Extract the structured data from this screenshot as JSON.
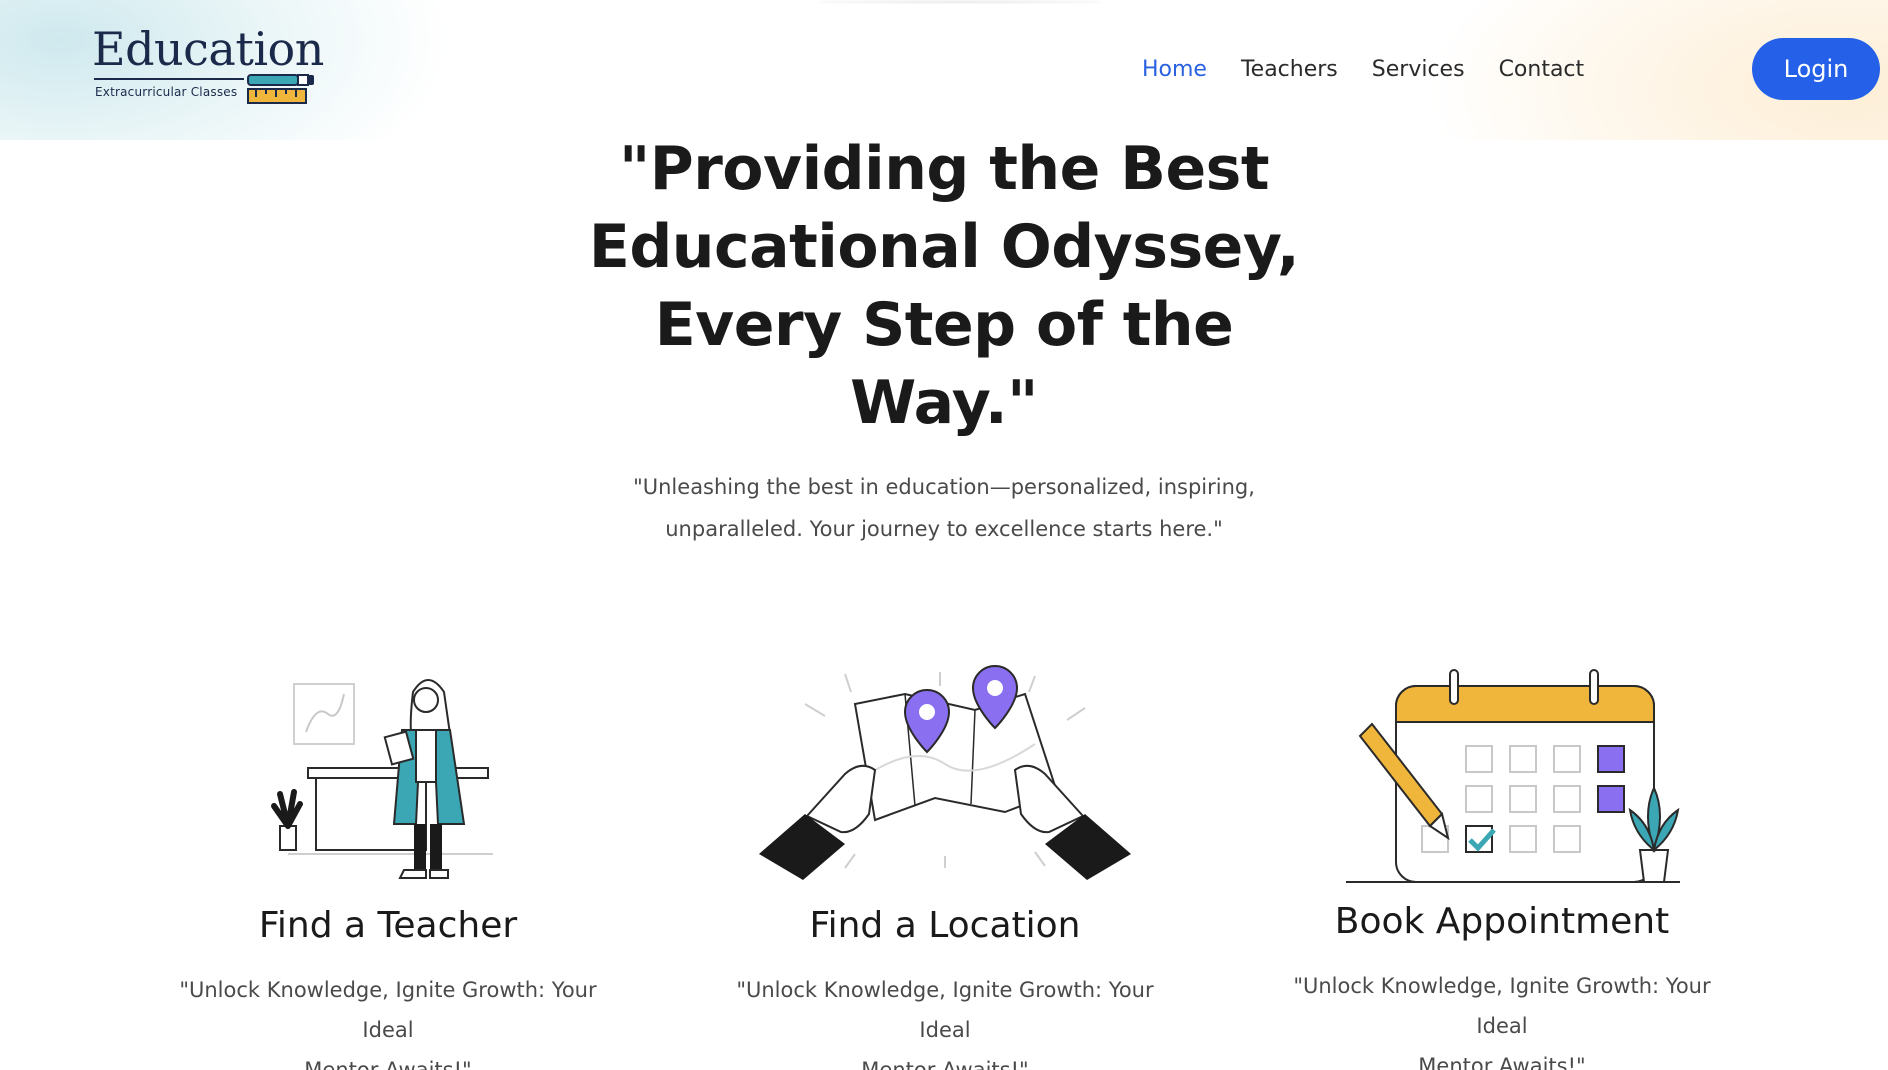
{
  "brand": {
    "title": "Education",
    "subtitle": "Extracurricular Classes"
  },
  "nav": {
    "items": [
      {
        "label": "Home",
        "active": true
      },
      {
        "label": "Teachers",
        "active": false
      },
      {
        "label": "Services",
        "active": false
      },
      {
        "label": "Contact",
        "active": false
      }
    ],
    "login_label": "Login"
  },
  "hero": {
    "title_lines": [
      "\"Providing the Best",
      "Educational Odyssey,",
      "Every Step of the",
      "Way.\""
    ],
    "subtitle_lines": [
      "\"Unleashing the best in education—personalized, inspiring,",
      "unparalleled. Your journey to excellence starts here.\""
    ]
  },
  "features": [
    {
      "title": "Find a Teacher",
      "desc_lines": [
        "\"Unlock Knowledge, Ignite Growth: Your Ideal",
        "Mentor Awaits!\""
      ]
    },
    {
      "title": "Find a Location",
      "desc_lines": [
        "\"Unlock Knowledge, Ignite Growth: Your Ideal",
        "Mentor Awaits!\""
      ]
    },
    {
      "title": "Book Appointment",
      "desc_lines": [
        "\"Unlock Knowledge, Ignite Growth: Your Ideal",
        "Mentor Awaits!\""
      ]
    }
  ],
  "colors": {
    "accent": "#2461e8",
    "nav_active": "#2962e0",
    "teal": "#3ba6b4",
    "purple": "#8a6ff0",
    "calendar_header": "#f0b63c",
    "dark": "#1a1a1a"
  },
  "icons": {
    "logo": "pencil-ruler-icon",
    "teacher": "teacher-illustration",
    "location": "map-pins-illustration",
    "appointment": "calendar-illustration"
  }
}
